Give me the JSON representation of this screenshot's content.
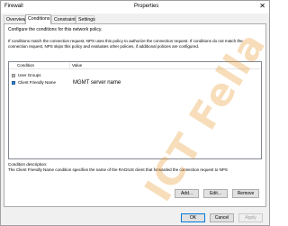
{
  "window": {
    "title": "Firewall",
    "subtitle": "Properties",
    "close_glyph": "✕"
  },
  "tabs": [
    {
      "label": "Overview",
      "active": false
    },
    {
      "label": "Conditions",
      "active": true
    },
    {
      "label": "Constraints",
      "active": false
    },
    {
      "label": "Settings",
      "active": false
    }
  ],
  "panel": {
    "intro": "Configure the conditions for this network policy.",
    "description": "If conditions match the connection request, NPS uses this policy to authorize the connection request. If conditions do not match the connection request, NPS skips this policy and evaluates other policies, if additional policies are configured.",
    "table": {
      "headers": [
        "Condition",
        "Value"
      ],
      "rows": [
        {
          "condition": "User Groups",
          "value": "",
          "icon": "user-groups-icon"
        },
        {
          "condition": "Client Friendly Name",
          "value": "MGMT server name",
          "icon": "client-name-icon"
        }
      ]
    },
    "condition_description_label": "Condition description:",
    "condition_description": "The Client Friendly Name condition specifies the name of the RADIUS client that forwarded the connection request to NPS",
    "buttons": {
      "add": "Add...",
      "edit": "Edit...",
      "remove": "Remove"
    }
  },
  "footer": {
    "ok": "OK",
    "cancel": "Cancel",
    "apply": "Apply"
  },
  "watermark": "ICT Fella"
}
